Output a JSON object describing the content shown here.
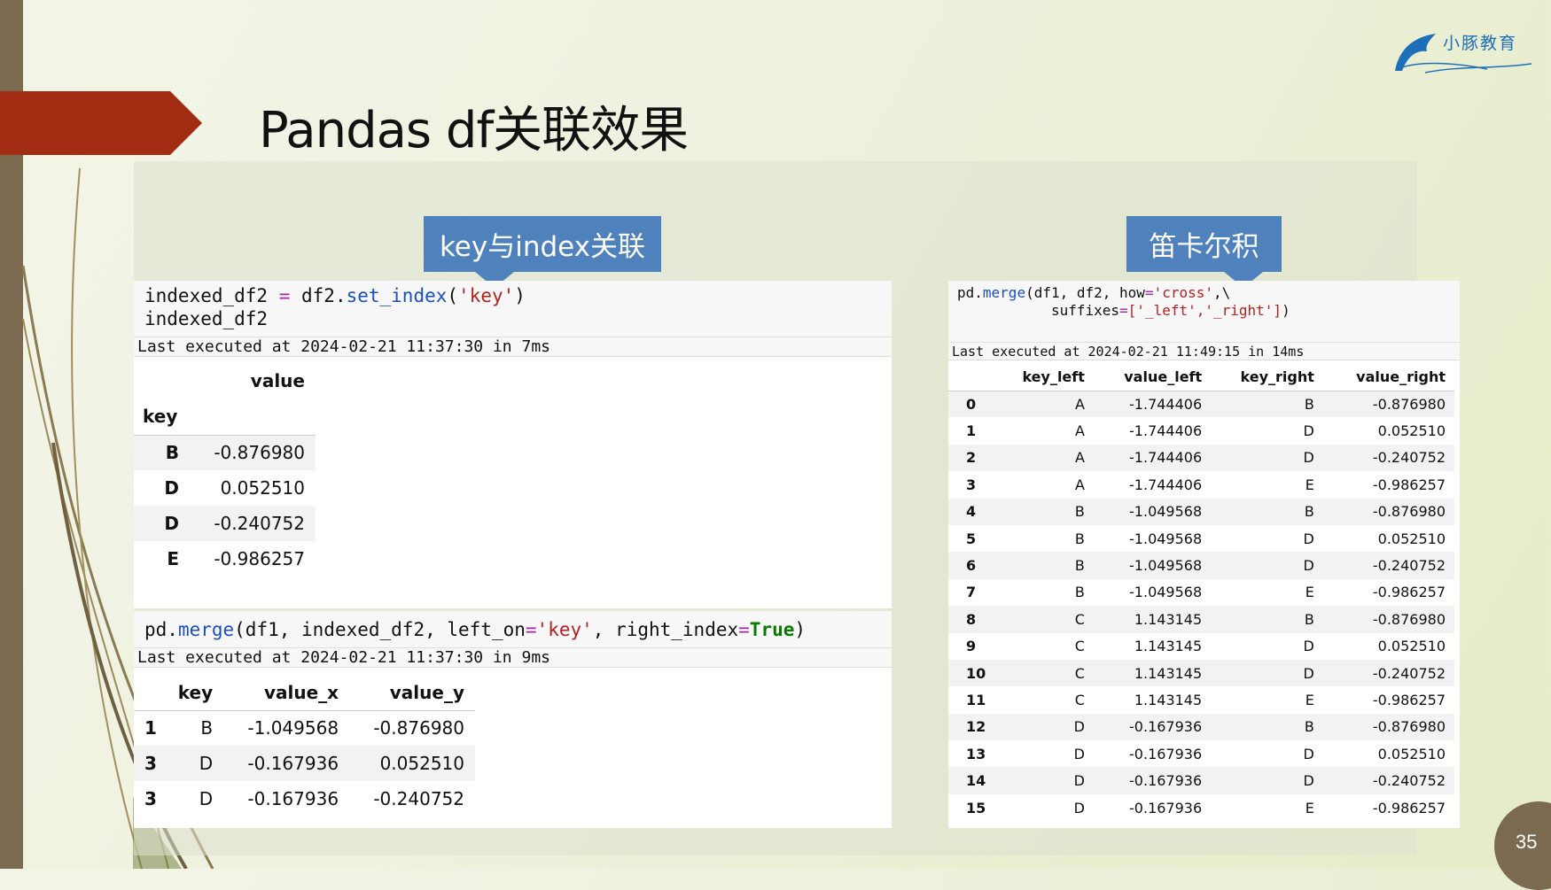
{
  "slide": {
    "title": "Pandas df关联效果",
    "page_number": "35",
    "logo_text": "小豚教育"
  },
  "callouts": {
    "left": "key与index关联",
    "right": "笛卡尔积"
  },
  "cell1": {
    "code_line1": {
      "a": "indexed_df2 ",
      "op": "=",
      "b": " df2.",
      "fn": "set_index",
      "c": "(",
      "s": "'key'",
      "d": ")"
    },
    "code_line2": "indexed_df2",
    "exec": "Last executed at 2024-02-21 11:37:30 in 7ms",
    "header_col": "value",
    "index_name": "key",
    "rows": [
      {
        "k": "B",
        "v": "-0.876980"
      },
      {
        "k": "D",
        "v": "0.052510"
      },
      {
        "k": "D",
        "v": "-0.240752"
      },
      {
        "k": "E",
        "v": "-0.986257"
      }
    ]
  },
  "cell2": {
    "code": {
      "a": "pd.",
      "fn": "merge",
      "b": "(df1, indexed_df2, left_on",
      "op1": "=",
      "s": "'key'",
      "c": ", right_index",
      "op2": "=",
      "t": "True",
      "d": ")"
    },
    "exec": "Last executed at 2024-02-21 11:37:30 in 9ms",
    "headers": [
      "",
      "key",
      "value_x",
      "value_y"
    ],
    "rows": [
      [
        "1",
        "B",
        "-1.049568",
        "-0.876980"
      ],
      [
        "3",
        "D",
        "-0.167936",
        "0.052510"
      ],
      [
        "3",
        "D",
        "-0.167936",
        "-0.240752"
      ]
    ]
  },
  "cell3": {
    "code_line1": {
      "a": "pd.",
      "fn": "merge",
      "b": "(df1, df2, how",
      "op": "=",
      "s": "'cross'",
      "c": ",\\"
    },
    "code_line2": {
      "pad": "           suffixes",
      "op": "=",
      "s": "['_left','_right']",
      "d": ")"
    },
    "exec": "Last executed at 2024-02-21 11:49:15 in 14ms",
    "headers": [
      "",
      "key_left",
      "value_left",
      "key_right",
      "value_right"
    ],
    "rows": [
      [
        "0",
        "A",
        "-1.744406",
        "B",
        "-0.876980"
      ],
      [
        "1",
        "A",
        "-1.744406",
        "D",
        "0.052510"
      ],
      [
        "2",
        "A",
        "-1.744406",
        "D",
        "-0.240752"
      ],
      [
        "3",
        "A",
        "-1.744406",
        "E",
        "-0.986257"
      ],
      [
        "4",
        "B",
        "-1.049568",
        "B",
        "-0.876980"
      ],
      [
        "5",
        "B",
        "-1.049568",
        "D",
        "0.052510"
      ],
      [
        "6",
        "B",
        "-1.049568",
        "D",
        "-0.240752"
      ],
      [
        "7",
        "B",
        "-1.049568",
        "E",
        "-0.986257"
      ],
      [
        "8",
        "C",
        "1.143145",
        "B",
        "-0.876980"
      ],
      [
        "9",
        "C",
        "1.143145",
        "D",
        "0.052510"
      ],
      [
        "10",
        "C",
        "1.143145",
        "D",
        "-0.240752"
      ],
      [
        "11",
        "C",
        "1.143145",
        "E",
        "-0.986257"
      ],
      [
        "12",
        "D",
        "-0.167936",
        "B",
        "-0.876980"
      ],
      [
        "13",
        "D",
        "-0.167936",
        "D",
        "0.052510"
      ],
      [
        "14",
        "D",
        "-0.167936",
        "D",
        "-0.240752"
      ],
      [
        "15",
        "D",
        "-0.167936",
        "E",
        "-0.986257"
      ]
    ]
  },
  "colors": {
    "accent_red": "#a32d12",
    "callout_blue": "#4f81bd",
    "left_bar": "#7b6a50"
  }
}
